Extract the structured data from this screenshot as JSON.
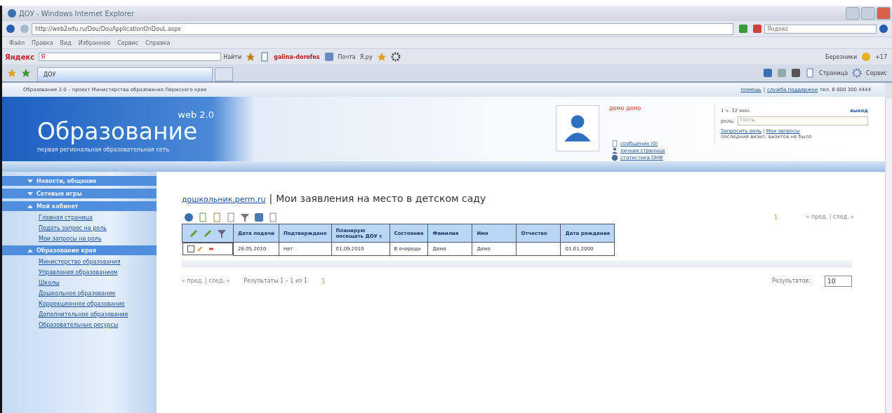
{
  "window": {
    "title": "ДОУ - Windows Internet Explorer"
  },
  "address_bar": {
    "url": "http://web2edu.ru/Dou/DouApplicationOnDouL.aspx",
    "search_placeholder": "Яндекс"
  },
  "menu": [
    "Файл",
    "Правка",
    "Вид",
    "Избранное",
    "Сервис",
    "Справка"
  ],
  "yandex_bar": {
    "label": "Яндекс",
    "field_value": "Я",
    "find": "Найти",
    "user": "galina-dorofes",
    "mail": "Почта",
    "yaru": "Я.ру",
    "city": "Березники",
    "temperature": "+17"
  },
  "tabs": [
    {
      "label": "ДОУ",
      "selected": true
    }
  ],
  "command_bar": [
    "Страница",
    "Сервис"
  ],
  "site": {
    "tagline": "Образование 2.0 – проект Министерства образования Пермского края",
    "help_links": [
      {
        "text": "помощь"
      },
      {
        "text": "служба поддержки"
      }
    ],
    "help_separator": "|",
    "phone": "тел. 8 800 300 4444",
    "logo": {
      "version": "web 2.0",
      "name": "Образование",
      "slogan": "первая региональная образовательная сеть"
    },
    "user": {
      "name": "демо демо",
      "links": [
        "сообщения (0)",
        "личная страница",
        "статистика ОНФ"
      ]
    },
    "session": {
      "time": "1 ч. 32 мин.",
      "logout": "выход",
      "role_label": "роль:",
      "role_value": "Гость",
      "request_role": "Запросить роль",
      "links_separator": "|",
      "my_requests": "Мои запросы",
      "last_visit": "последний визит: визитов не было"
    }
  },
  "sidebar": [
    {
      "title": "Новости, общение",
      "expanded": false
    },
    {
      "title": "Сетевые игры",
      "expanded": false
    },
    {
      "title": "Мой кабинет",
      "expanded": true,
      "items": [
        "Главная страница",
        "Подать запрос на роль",
        "Мои запросы на роль"
      ]
    },
    {
      "title": "Образование края",
      "expanded": true,
      "items": [
        "Министерство образования",
        "Управления образованием",
        "Школы",
        "Дошкольное образование",
        "Коррекционное образование",
        "Дополнительное образование",
        "Образовательные ресурсы"
      ]
    }
  ],
  "page": {
    "site_link": "дошкольник.perm.ru",
    "separator": "|",
    "title": "Мои заявления на место в детском саду"
  },
  "pager_top": {
    "page": "1",
    "nav": "« пред. | след. »"
  },
  "table": {
    "columns": [
      "Дата подачи",
      "Подтверждено",
      "Планирую посещать ДОУ с",
      "Состояние",
      "Фамилия",
      "Имя",
      "Отчество",
      "Дата рождения"
    ],
    "rows": [
      {
        "checked": false,
        "cells": [
          "26.05.2010",
          "Нет",
          "01.09.2010",
          "В очереди",
          "Демо",
          "Демо",
          "",
          "01.01.2000"
        ]
      }
    ]
  },
  "pager_bottom": {
    "nav": "« пред. | след. »",
    "results": "Результаты 1 – 1 из 1",
    "page": "1",
    "per_page_label": "Результатов:",
    "per_page": "10"
  }
}
